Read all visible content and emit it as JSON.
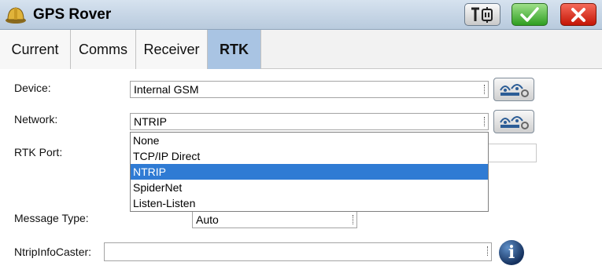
{
  "window": {
    "title": "GPS Rover",
    "app_icon": "hard-hat-icon",
    "tool_icon": "antenna-plug-icon",
    "ok_icon": "checkmark-icon",
    "cancel_icon": "close-x-icon"
  },
  "tabs": [
    {
      "label": "Current",
      "active": false
    },
    {
      "label": "Comms",
      "active": false
    },
    {
      "label": "Receiver",
      "active": false
    },
    {
      "label": "RTK",
      "active": true
    }
  ],
  "form": {
    "device": {
      "label": "Device:",
      "value": "Internal GSM"
    },
    "network": {
      "label": "Network:",
      "value": "NTRIP"
    },
    "rtk_port": {
      "label": "RTK Port:"
    },
    "message_type": {
      "label": "Message Type:",
      "value": "Auto"
    },
    "ntrip_info_caster": {
      "label": "NtripInfoCaster:",
      "value": ""
    }
  },
  "network_dropdown": {
    "options": [
      "None",
      "TCP/IP Direct",
      "NTRIP",
      "SpiderNet",
      "Listen-Listen"
    ],
    "selected": "NTRIP"
  },
  "colors": {
    "titlebar": "#c6d5e6",
    "active_tab": "#a9c4e3",
    "selection": "#2f7bd4",
    "ok": "#2f9e21",
    "cancel": "#c41505"
  },
  "icons": {
    "config": "satellite-config-icon",
    "info": "info-icon",
    "info_glyph": "i"
  }
}
